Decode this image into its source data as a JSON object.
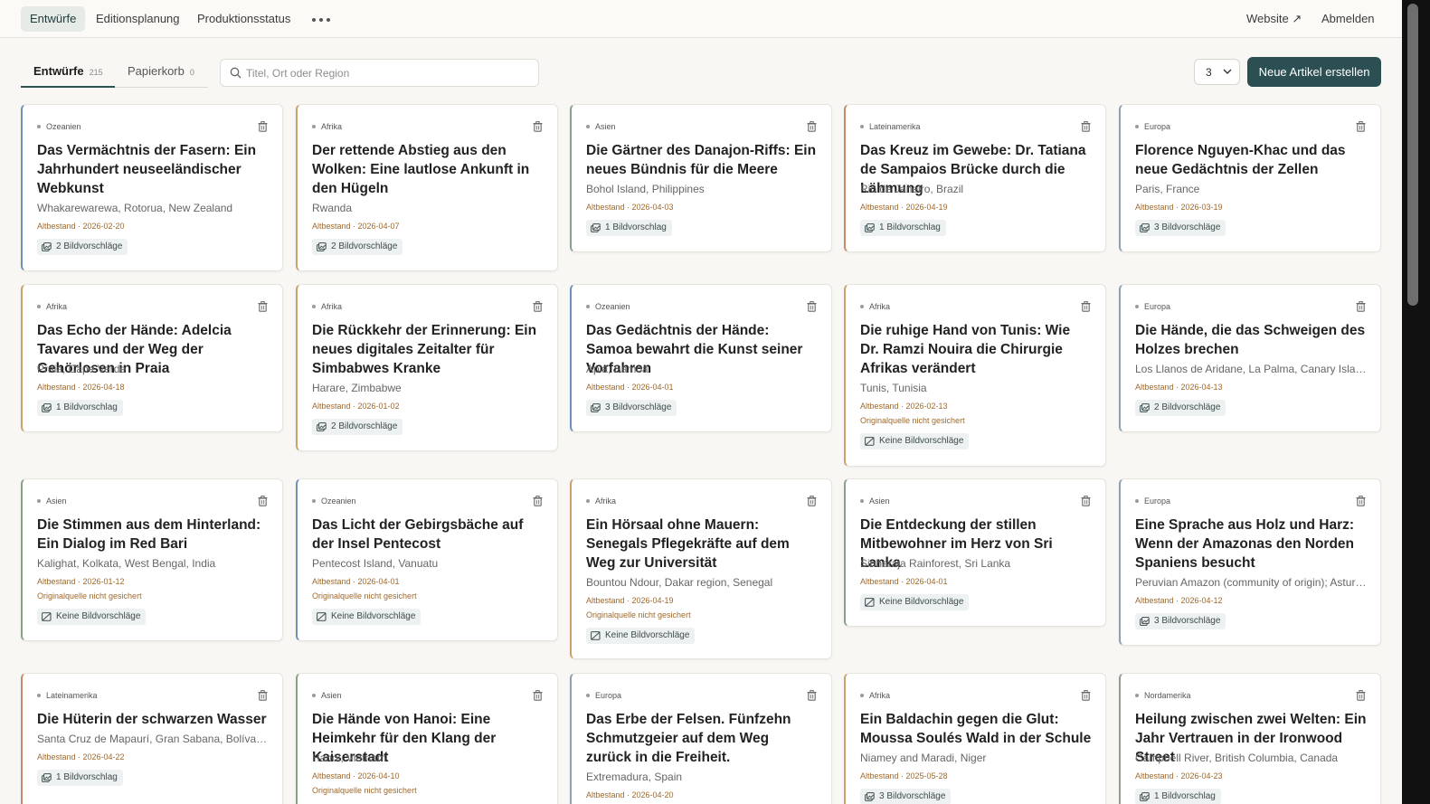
{
  "nav": {
    "items": [
      "Entwürfe",
      "Editionsplanung",
      "Produktionsstatus"
    ],
    "website_label": "Website ↗",
    "logout_label": "Abmelden"
  },
  "tabs": [
    {
      "label": "Entwürfe",
      "count": "215"
    },
    {
      "label": "Papierkorb",
      "count": "0"
    }
  ],
  "search": {
    "placeholder": "Titel, Ort oder Region"
  },
  "columns_select": {
    "value": "3"
  },
  "new_article_label": "Neue Artikel erstellen",
  "colors": {
    "accent": "#2b4f52",
    "warning": "#a0692b",
    "active_nav_bg": "#e6ebe7"
  },
  "cards": [
    {
      "region": "Ozeanien",
      "title": "Das Vermächtnis der Fasern: Ein Jahrhundert neuseeländischer Webkunst",
      "location": "Whakarewarewa, Rotorua, New Zealand",
      "meta": "Altbestand · 2026-02-20",
      "warning": "",
      "images": "2 Bildvorschläge"
    },
    {
      "region": "Afrika",
      "title": "Der rettende Abstieg aus den Wolken: Eine lautlose Ankunft in den Hügeln",
      "location": "Rwanda",
      "meta": "Altbestand · 2026-04-07",
      "warning": "",
      "images": "2 Bildvorschläge"
    },
    {
      "region": "Asien",
      "title": "Die Gärtner des Danajon-Riffs: Ein neues Bündnis für die Meere",
      "location": "Bohol Island, Philippines",
      "meta": "Altbestand · 2026-04-03",
      "warning": "",
      "images": "1 Bildvorschlag"
    },
    {
      "region": "Lateinamerika",
      "title": "Das Kreuz im Gewebe: Dr. Tatiana de Sampaios Brücke durch die Lähmung",
      "location": "Rio de Janeiro, Brazil",
      "meta": "Altbestand · 2026-04-19",
      "warning": "",
      "images": "1 Bildvorschlag"
    },
    {
      "region": "Europa",
      "title": "Florence Nguyen-Khac und das neue Gedächtnis der Zellen",
      "location": "Paris, France",
      "meta": "Altbestand · 2026-03-19",
      "warning": "",
      "images": "3 Bildvorschläge"
    },
    {
      "region": "Afrika",
      "title": "Das Echo der Hände: Adelcia Tavares und der Weg der Gehörlosen in Praia",
      "location": "Praia, Cape Verde",
      "meta": "Altbestand · 2026-04-18",
      "warning": "",
      "images": "1 Bildvorschlag"
    },
    {
      "region": "Afrika",
      "title": "Die Rückkehr der Erinnerung: Ein neues digitales Zeitalter für Simbabwes Kranke",
      "location": "Harare, Zimbabwe",
      "meta": "Altbestand · 2026-01-02",
      "warning": "",
      "images": "2 Bildvorschläge"
    },
    {
      "region": "Ozeanien",
      "title": "Das Gedächtnis der Hände: Samoa bewahrt die Kunst seiner Vorfahren",
      "location": "Apia, Samoa",
      "meta": "Altbestand · 2026-04-01",
      "warning": "",
      "images": "3 Bildvorschläge"
    },
    {
      "region": "Afrika",
      "title": "Die ruhige Hand von Tunis: Wie Dr. Ramzi Nouira die Chirurgie Afrikas verändert",
      "location": "Tunis, Tunisia",
      "meta": "Altbestand · 2026-02-13",
      "warning": "Originalquelle nicht gesichert",
      "images": "Keine Bildvorschläge"
    },
    {
      "region": "Europa",
      "title": "Die Hände, die das Schweigen des Holzes brechen",
      "location": "Los Llanos de Aridane, La Palma, Canary Islands, Spain",
      "meta": "Altbestand · 2026-04-13",
      "warning": "",
      "images": "2 Bildvorschläge"
    },
    {
      "region": "Asien",
      "title": "Die Stimmen aus dem Hinterland: Ein Dialog im Red Bari",
      "location": "Kalighat, Kolkata, West Bengal, India",
      "meta": "Altbestand · 2026-01-12",
      "warning": "Originalquelle nicht gesichert",
      "images": "Keine Bildvorschläge"
    },
    {
      "region": "Ozeanien",
      "title": "Das Licht der Gebirgsbäche auf der Insel Pentecost",
      "location": "Pentecost Island, Vanuatu",
      "meta": "Altbestand · 2026-04-01",
      "warning": "Originalquelle nicht gesichert",
      "images": "Keine Bildvorschläge"
    },
    {
      "region": "Afrika",
      "title": "Ein Hörsaal ohne Mauern: Senegals Pflegekräfte auf dem Weg zur Universität",
      "location": "Bountou Ndour, Dakar region, Senegal",
      "meta": "Altbestand · 2026-04-19",
      "warning": "Originalquelle nicht gesichert",
      "images": "Keine Bildvorschläge"
    },
    {
      "region": "Asien",
      "title": "Die Entdeckung der stillen Mitbewohner im Herz von Sri Lanka",
      "location": "Sinharaja Rainforest, Sri Lanka",
      "meta": "Altbestand · 2026-04-01",
      "warning": "",
      "images": "Keine Bildvorschläge"
    },
    {
      "region": "Europa",
      "title": "Eine Sprache aus Holz und Harz: Wenn der Amazonas den Norden Spaniens besucht",
      "location": "Peruvian Amazon (community of origin); Asturias, Spain",
      "meta": "Altbestand · 2026-04-12",
      "warning": "",
      "images": "3 Bildvorschläge"
    },
    {
      "region": "Lateinamerika",
      "title": "Die Hüterin der schwarzen Wasser",
      "location": "Santa Cruz de Mapaurí, Gran Sabana, Bolívar, Venezuela",
      "meta": "Altbestand · 2026-04-22",
      "warning": "",
      "images": "1 Bildvorschlag"
    },
    {
      "region": "Asien",
      "title": "Die Hände von Hanoi: Eine Heimkehr für den Klang der Kaiserstadt",
      "location": "Hanoi, Vietnam",
      "meta": "Altbestand · 2026-04-10",
      "warning": "Originalquelle nicht gesichert",
      "images": ""
    },
    {
      "region": "Europa",
      "title": "Das Erbe der Felsen. Fünfzehn Schmutzgeier auf dem Weg zurück in die Freiheit.",
      "location": "Extremadura, Spain",
      "meta": "Altbestand · 2026-04-20",
      "warning": "",
      "images": ""
    },
    {
      "region": "Afrika",
      "title": "Ein Baldachin gegen die Glut: Moussa Soulés Wald in der Schule",
      "location": "Niamey and Maradi, Niger",
      "meta": "Altbestand · 2025-05-28",
      "warning": "",
      "images": "3 Bildvorschläge"
    },
    {
      "region": "Nordamerika",
      "title": "Heilung zwischen zwei Welten: Ein Jahr Vertrauen in der Ironwood Street",
      "location": "Campbell River, British Columbia, Canada",
      "meta": "Altbestand · 2026-04-23",
      "warning": "",
      "images": "1 Bildvorschlag"
    }
  ]
}
